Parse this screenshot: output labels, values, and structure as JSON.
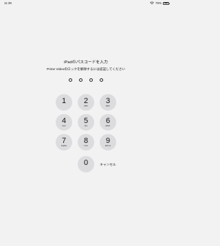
{
  "status_bar": {
    "time": "11:39",
    "battery_percent": "79%",
    "battery_level": 0.79,
    "icons": [
      "wifi-icon",
      "battery-icon"
    ]
  },
  "passcode": {
    "title": "iPadのパスコードを入力",
    "subtitle": "Prime Videoのロックを解除するには認証してください",
    "digits_entered": 0,
    "digits_total": 4
  },
  "keypad": {
    "keys": [
      {
        "digit": "1",
        "letters": ""
      },
      {
        "digit": "2",
        "letters": "ABC"
      },
      {
        "digit": "3",
        "letters": "DEF"
      },
      {
        "digit": "4",
        "letters": "GHI"
      },
      {
        "digit": "5",
        "letters": "JKL"
      },
      {
        "digit": "6",
        "letters": "MNO"
      },
      {
        "digit": "7",
        "letters": "PQRS"
      },
      {
        "digit": "8",
        "letters": "TUV"
      },
      {
        "digit": "9",
        "letters": "WXYZ"
      },
      {
        "digit": "0",
        "letters": ""
      }
    ],
    "cancel_label": "キャンセル"
  },
  "colors": {
    "background": "#f2f2f3",
    "key_background": "#dcdcdf",
    "text": "#111111"
  }
}
